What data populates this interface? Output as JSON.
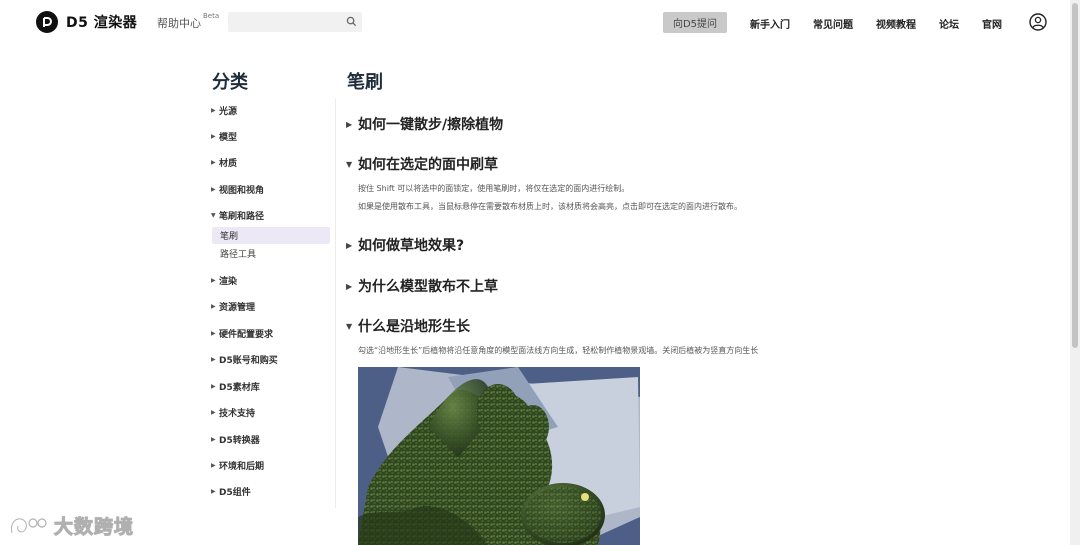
{
  "header": {
    "brand": "D5 渲染器",
    "help_center": "帮助中心",
    "beta_badge": "Beta",
    "search_placeholder": "",
    "ask_button": "向D5提问",
    "nav": [
      "新手入门",
      "常见问题",
      "视频教程",
      "论坛",
      "官网"
    ]
  },
  "sidebar": {
    "title": "分类",
    "items": [
      {
        "label": "光源",
        "expanded": false
      },
      {
        "label": "模型",
        "expanded": false
      },
      {
        "label": "材质",
        "expanded": false
      },
      {
        "label": "视图和视角",
        "expanded": false
      },
      {
        "label": "笔刷和路径",
        "expanded": true
      },
      {
        "label": "渲染",
        "expanded": false
      },
      {
        "label": "资源管理",
        "expanded": false
      },
      {
        "label": "硬件配置要求",
        "expanded": false
      },
      {
        "label": "D5账号和购买",
        "expanded": false
      },
      {
        "label": "D5素材库",
        "expanded": false
      },
      {
        "label": "技术支持",
        "expanded": false
      },
      {
        "label": "D5转换器",
        "expanded": false
      },
      {
        "label": "环境和后期",
        "expanded": false
      },
      {
        "label": "D5组件",
        "expanded": false
      }
    ],
    "sub_items": [
      {
        "label": "笔刷",
        "active": true
      },
      {
        "label": "路径工具",
        "active": false
      }
    ]
  },
  "main": {
    "title": "笔刷",
    "faqs": [
      {
        "question": "如何一键散步/擦除植物",
        "expanded": false
      },
      {
        "question": "如何在选定的面中刷草",
        "expanded": true,
        "answer": [
          "按住 Shift 可以将选中的面锁定，使用笔刷时，将仅在选定的面内进行绘制。",
          "如果是使用散布工具，当鼠标悬停在需要散布材质上时，该材质将会高亮，点击即可在选定的面内进行散布。"
        ]
      },
      {
        "question": "如何做草地效果?",
        "expanded": false
      },
      {
        "question": "为什么模型散布不上草",
        "expanded": false
      },
      {
        "question": "什么是沿地形生长",
        "expanded": true,
        "answer": [
          "勾选“沿地形生长”后植物将沿任意角度的模型面法线方向生成，轻松制作植物景观墙。关闭后植被为竖直方向生长"
        ]
      }
    ]
  },
  "watermark": "大数跨境",
  "colors": {
    "accent": "#ece8f6",
    "brand": "#111111",
    "heading": "#1f2d3a"
  }
}
